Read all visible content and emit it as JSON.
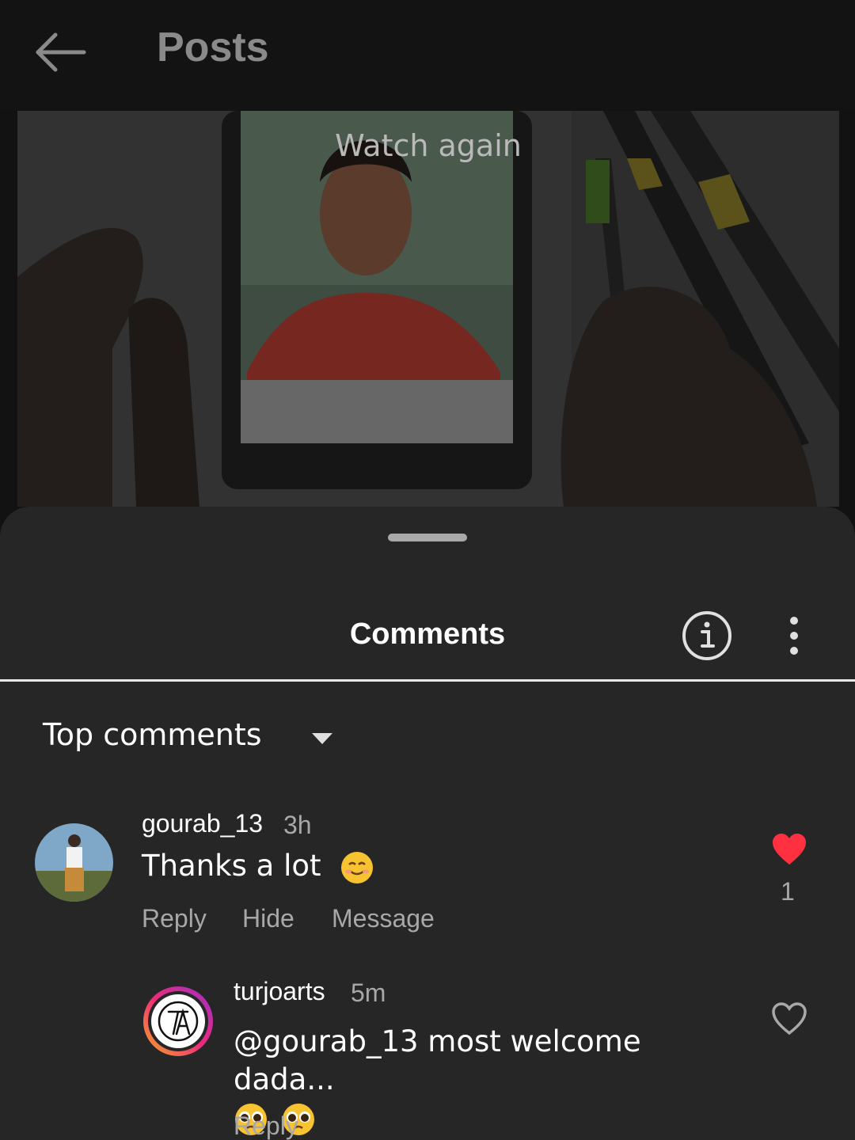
{
  "header": {
    "title": "Posts",
    "back_icon": "arrow-left-icon"
  },
  "video": {
    "overlay_text": "Watch again"
  },
  "sheet": {
    "title": "Comments",
    "info_icon": "info-icon",
    "more_icon": "more-vertical-icon",
    "sort_label": "Top comments",
    "sort_icon": "caret-down-icon"
  },
  "comments": [
    {
      "username": "gourab_13",
      "time": "3h",
      "text": "Thanks a lot",
      "emoji": "smiling-face-icon",
      "actions": [
        "Reply",
        "Hide",
        "Message"
      ],
      "liked": true,
      "like_count": "1",
      "like_color": "#ff3040"
    },
    {
      "username": "turjoarts",
      "time": "5m",
      "mention": "@gourab_13",
      "text": "most welcome dada...",
      "emoji": "pleading-face-icon",
      "actions": [
        "Reply"
      ],
      "liked": false
    }
  ],
  "colors": {
    "background": "#121212",
    "sheet": "#262626",
    "secondary_text": "#a8a8a8",
    "like_red": "#ff3040"
  }
}
